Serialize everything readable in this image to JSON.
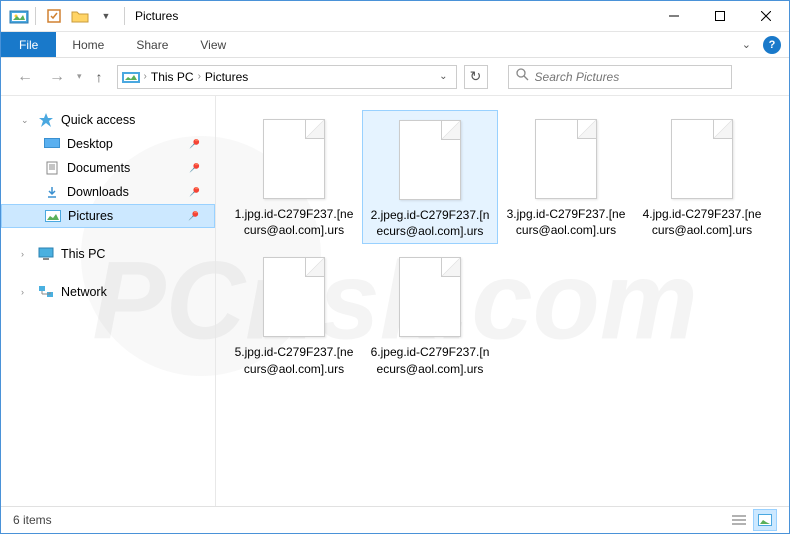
{
  "window": {
    "title_separator": "|",
    "title": "Pictures"
  },
  "ribbon": {
    "file": "File",
    "tabs": [
      "Home",
      "Share",
      "View"
    ]
  },
  "breadcrumb": {
    "items": [
      "This PC",
      "Pictures"
    ]
  },
  "search": {
    "placeholder": "Search Pictures"
  },
  "sidebar": {
    "quick_access": {
      "label": "Quick access",
      "items": [
        {
          "label": "Desktop",
          "pinned": true,
          "icon": "desktop"
        },
        {
          "label": "Documents",
          "pinned": true,
          "icon": "documents"
        },
        {
          "label": "Downloads",
          "pinned": true,
          "icon": "downloads"
        },
        {
          "label": "Pictures",
          "pinned": true,
          "icon": "pictures",
          "selected": true
        }
      ]
    },
    "this_pc": "This PC",
    "network": "Network"
  },
  "files": [
    {
      "name": "1.jpg.id-C279F237.[necurs@aol.com].urs",
      "selected": false
    },
    {
      "name": "2.jpeg.id-C279F237.[necurs@aol.com].urs",
      "selected": true
    },
    {
      "name": "3.jpg.id-C279F237.[necurs@aol.com].urs",
      "selected": false
    },
    {
      "name": "4.jpg.id-C279F237.[necurs@aol.com].urs",
      "selected": false
    },
    {
      "name": "5.jpg.id-C279F237.[necurs@aol.com].urs",
      "selected": false
    },
    {
      "name": "6.jpeg.id-C279F237.[necurs@aol.com].urs",
      "selected": false
    }
  ],
  "statusbar": {
    "count": "6 items"
  },
  "watermark": "PCrisk.com"
}
